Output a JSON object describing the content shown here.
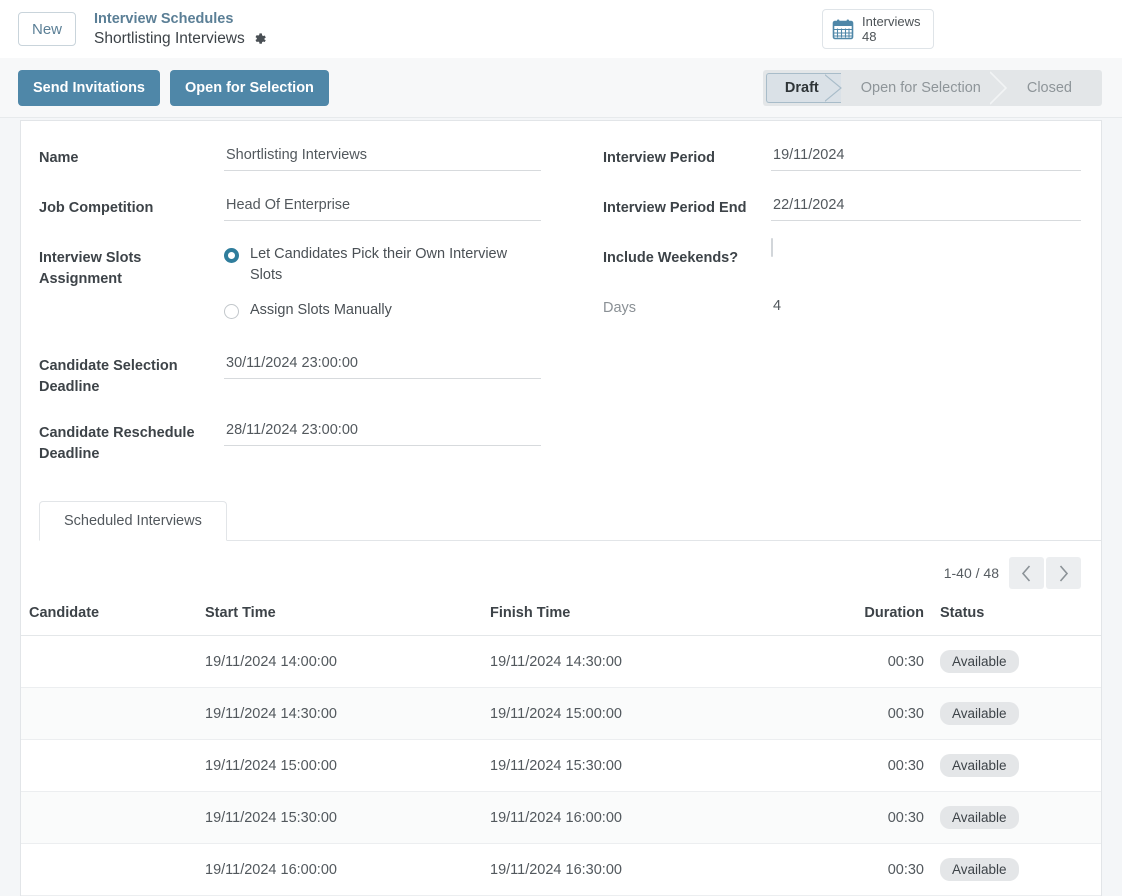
{
  "header": {
    "new_button": "New",
    "breadcrumb": "Interview Schedules",
    "record_title": "Shortlisting Interviews",
    "gear_icon": "gear-icon",
    "chip": {
      "icon": "calendar-icon",
      "label": "Interviews",
      "count": "48"
    }
  },
  "actions": {
    "send_invitations": "Send Invitations",
    "open_for_selection": "Open for Selection"
  },
  "status_flow": {
    "stages": [
      {
        "label": "Draft",
        "active": true
      },
      {
        "label": "Open for Selection",
        "active": false
      },
      {
        "label": "Closed",
        "active": false
      }
    ]
  },
  "form": {
    "left": {
      "name_label": "Name",
      "name_value": "Shortlisting Interviews",
      "job_competition_label": "Job Competition",
      "job_competition_value": "Head Of Enterprise",
      "slots_assignment_label": "Interview Slots Assignment",
      "slots_options": [
        {
          "label": "Let Candidates Pick their Own Interview Slots",
          "selected": true
        },
        {
          "label": "Assign Slots Manually",
          "selected": false
        }
      ],
      "selection_deadline_label": "Candidate Selection Deadline",
      "selection_deadline_value": "30/11/2024 23:00:00",
      "reschedule_deadline_label": "Candidate Reschedule Deadline",
      "reschedule_deadline_value": "28/11/2024 23:00:00"
    },
    "right": {
      "period_label": "Interview Period",
      "period_value": "19/11/2024",
      "period_end_label": "Interview Period End",
      "period_end_value": "22/11/2024",
      "weekends_label": "Include Weekends?",
      "weekends_checked": false,
      "days_label": "Days",
      "days_value": "4"
    }
  },
  "tabs": [
    {
      "label": "Scheduled Interviews",
      "active": true
    }
  ],
  "pagination": {
    "range": "1-40 / 48",
    "prev_icon": "chevron-left-icon",
    "next_icon": "chevron-right-icon"
  },
  "table": {
    "columns": [
      "Candidate",
      "Start Time",
      "Finish Time",
      "Duration",
      "Status"
    ],
    "rows": [
      {
        "candidate": "",
        "start": "19/11/2024 14:00:00",
        "finish": "19/11/2024 14:30:00",
        "duration": "00:30",
        "status": "Available"
      },
      {
        "candidate": "",
        "start": "19/11/2024 14:30:00",
        "finish": "19/11/2024 15:00:00",
        "duration": "00:30",
        "status": "Available"
      },
      {
        "candidate": "",
        "start": "19/11/2024 15:00:00",
        "finish": "19/11/2024 15:30:00",
        "duration": "00:30",
        "status": "Available"
      },
      {
        "candidate": "",
        "start": "19/11/2024 15:30:00",
        "finish": "19/11/2024 16:00:00",
        "duration": "00:30",
        "status": "Available"
      },
      {
        "candidate": "",
        "start": "19/11/2024 16:00:00",
        "finish": "19/11/2024 16:30:00",
        "duration": "00:30",
        "status": "Available"
      }
    ]
  },
  "colors": {
    "accent_blue": "#4f87a8",
    "link_blue": "#5b7f96",
    "radio_on": "#2f7d9c",
    "page_bg": "#f4f6f8"
  }
}
